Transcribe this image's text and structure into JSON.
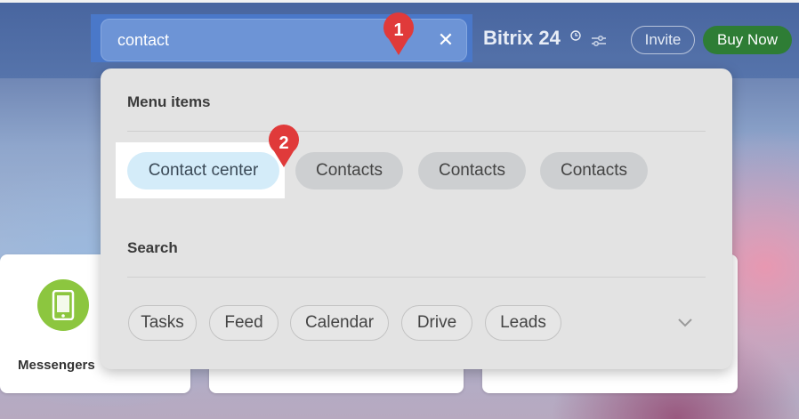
{
  "search": {
    "value": "contact"
  },
  "header": {
    "brand": "Bitrix 24",
    "invite_label": "Invite",
    "buynow_label": "Buy Now"
  },
  "background": {
    "card_label": "Messengers"
  },
  "dropdown": {
    "menu_title": "Menu items",
    "menu_items": [
      "Contact center",
      "Contacts",
      "Contacts",
      "Contacts"
    ],
    "search_title": "Search",
    "search_tags": [
      "Tasks",
      "Feed",
      "Calendar",
      "Drive",
      "Leads"
    ]
  },
  "annotations": {
    "step1": "1",
    "step2": "2"
  },
  "colors": {
    "accent_blue": "#4a78c9",
    "buy_now_green": "#2e7d35",
    "callout_red": "#e03a3a",
    "selected_chip": "#d4ecf9"
  }
}
